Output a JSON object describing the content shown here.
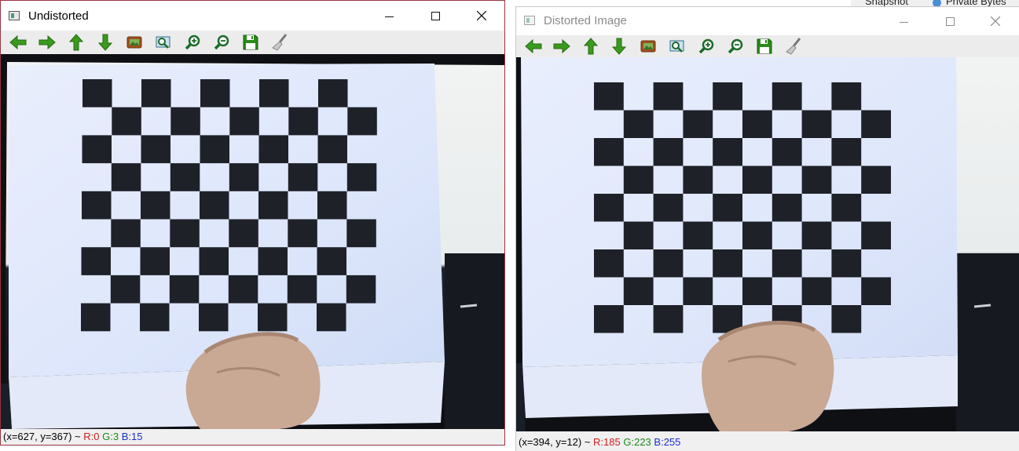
{
  "background_window": {
    "items": [
      "Snapshot",
      "Private Bytes"
    ]
  },
  "toolbar_icons": [
    "arrow-left-icon",
    "arrow-right-icon",
    "arrow-up-icon",
    "arrow-down-icon",
    "fit-image-icon",
    "zoom-rect-icon",
    "zoom-in-icon",
    "zoom-out-icon",
    "save-icon",
    "properties-brush-icon"
  ],
  "colors": {
    "arrow_green": "#3a9a1e",
    "save_green": "#2a8a1a",
    "status_r": "#d01c1c",
    "status_g": "#1a8a1a",
    "status_b": "#1c2dcc"
  },
  "windows": [
    {
      "title": "Undistorted",
      "status": {
        "coords": "(x=627, y=367) ~ ",
        "r": "R:0",
        "g": "G:3",
        "b": "B:15"
      }
    },
    {
      "title": "Distorted Image",
      "status": {
        "coords": "(x=394, y=12) ~ ",
        "r": "R:185",
        "g": "G:223",
        "b": "B:255"
      }
    }
  ]
}
